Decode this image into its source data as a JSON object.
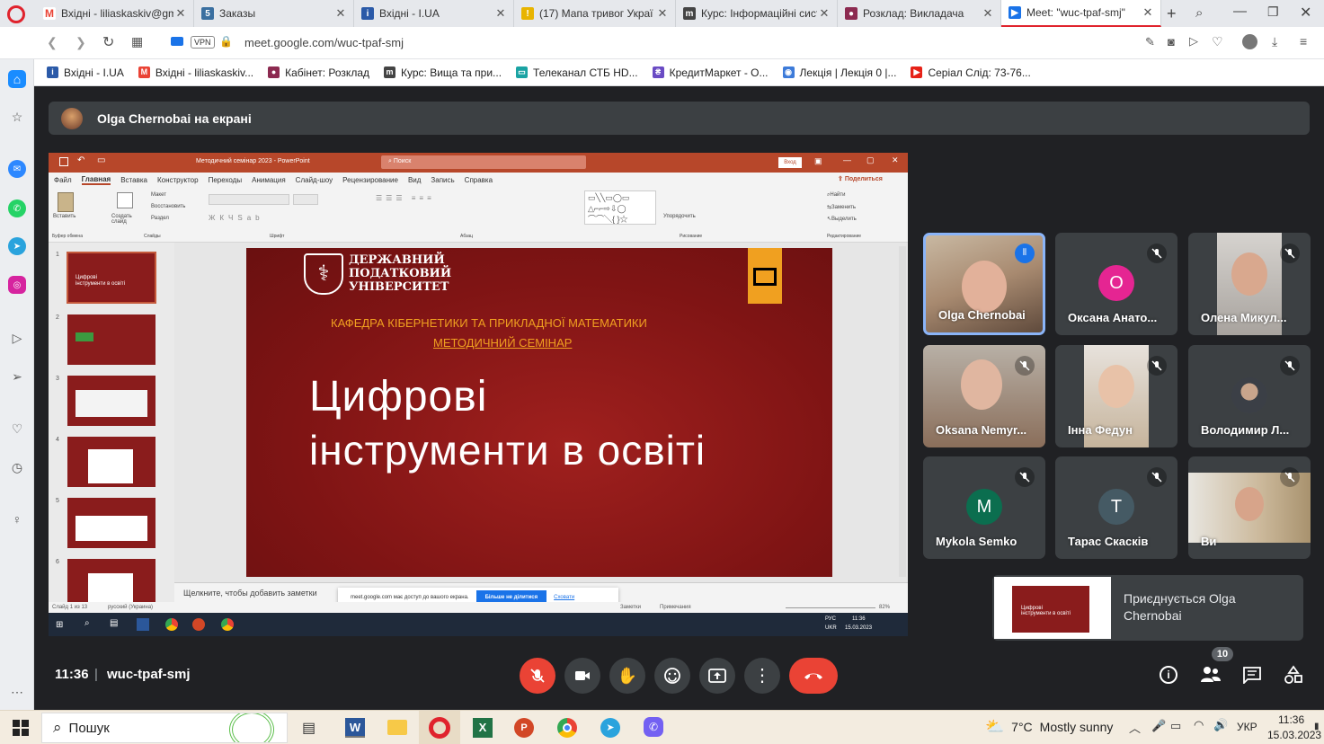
{
  "tabs": [
    {
      "label": "Вхідні - liliaskaskiv@gma",
      "icon": "gmail-icon",
      "color": "#ea4335"
    },
    {
      "label": "Заказы",
      "icon": "orders-icon",
      "color": "#3a6fa0"
    },
    {
      "label": "Вхідні - I.UA",
      "icon": "iua-icon",
      "color": "#2b5aa8"
    },
    {
      "label": "(17) Мапа тривог Украї",
      "icon": "alert-icon",
      "color": "#e8b400"
    },
    {
      "label": "Курс: Інформаційні сист",
      "icon": "moodle-icon",
      "color": "#444"
    },
    {
      "label": "Розклад: Викладача",
      "icon": "schedule-icon",
      "color": "#8c2a50"
    },
    {
      "label": "Meet: \"wuc-tpaf-smj\"",
      "icon": "meet-icon",
      "color": "#1a73e8"
    }
  ],
  "address": {
    "vpn": "VPN",
    "url": "meet.google.com/wuc-tpaf-smj"
  },
  "bookmarks": [
    {
      "label": "Вхідні - I.UA",
      "color": "#2b5aa8"
    },
    {
      "label": "Вхідні - liliaskaskiv...",
      "color": "#ea4335"
    },
    {
      "label": "Кабінет: Розклад",
      "color": "#8c2a50"
    },
    {
      "label": "Курс: Вища та при...",
      "color": "#444"
    },
    {
      "label": "Телеканал СТБ HD...",
      "color": "#1aa3a3"
    },
    {
      "label": "КредитМаркет - О...",
      "color": "#6a4bc4"
    },
    {
      "label": "Лекція | Лекція 0 |...",
      "color": "#3d7bd9"
    },
    {
      "label": "Серіал Слід: 73-76...",
      "color": "#e62117"
    }
  ],
  "banner": {
    "text": "Olga Chernobai на екрані"
  },
  "ppt": {
    "title": "Методичний семінар 2023 - PowerPoint",
    "search": "Поиск",
    "login": "Вход",
    "share": "Поделиться",
    "menu": [
      "Файл",
      "Главная",
      "Вставка",
      "Конструктор",
      "Переходы",
      "Анимация",
      "Слайд-шоу",
      "Рецензирование",
      "Вид",
      "Запись",
      "Справка"
    ],
    "groups": [
      "Буфер обмена",
      "Слайды",
      "Шрифт",
      "Абзац",
      "Рисование",
      "Редактирование"
    ],
    "ribbon": {
      "paste": "Вставить",
      "create": "Создать слайд",
      "layout": "Макет",
      "restore": "Восстановить",
      "section": "Раздел",
      "arrange": "Упорядочить",
      "find": "Найти",
      "replace": "Заменить",
      "select": "Выделить"
    },
    "slide": {
      "univ1": "ДЕРЖАВНИЙ",
      "univ2": "ПОДАТКОВИЙ",
      "univ3": "УНІВЕРСИТЕТ",
      "dept": "КАФЕДРА КІБЕРНЕТИКИ ТА ПРИКЛАДНОЇ МАТЕМАТИКИ",
      "seminar": "МЕТОДИЧНИЙ СЕМІНАР",
      "title1": "Цифрові",
      "title2": "інструменти в освіті"
    },
    "thumbs": [
      "1",
      "2",
      "3",
      "4",
      "5",
      "6"
    ],
    "notes": "Щелкните, чтобы добавить заметки",
    "sharebar": {
      "text": "meet.google.com має доступ до вашого екрана.",
      "stop": "Більше не ділитися",
      "hide": "Сховати"
    },
    "status": {
      "slide": "Слайд 1 из 13",
      "lang": "русский (Украина)",
      "notes": "Заметки",
      "comments": "Примечания",
      "zoom": "82%"
    },
    "tray": {
      "lang1": "РУС",
      "lang2": "UKR",
      "time": "11:36",
      "date": "15.03.2023"
    }
  },
  "participants": [
    {
      "name": "Olga Chernobai",
      "type": "video",
      "speaking": true
    },
    {
      "name": "Оксана Анато...",
      "type": "avatar",
      "letter": "О",
      "color": "#e52592"
    },
    {
      "name": "Олена Микул...",
      "type": "video"
    },
    {
      "name": "Oksana Nemyr...",
      "type": "video"
    },
    {
      "name": "Інна Федун",
      "type": "video"
    },
    {
      "name": "Володимир Л...",
      "type": "photo"
    },
    {
      "name": "Mykola Semko",
      "type": "avatar",
      "letter": "M",
      "color": "#0b6e4f"
    },
    {
      "name": "Тарас Скасків",
      "type": "avatar",
      "letter": "T",
      "color": "#455a64"
    },
    {
      "name": "Ви",
      "type": "video"
    }
  ],
  "joining": {
    "text": "Приєднується Olga Chernobai"
  },
  "bottom": {
    "time": "11:36",
    "separator": "|",
    "code": "wuc-tpaf-smj",
    "people_count": "10"
  },
  "taskbar": {
    "search": "Пошук",
    "weather_temp": "7°C",
    "weather_text": "Mostly sunny",
    "lang": "УКР",
    "time": "11:36",
    "date": "15.03.2023"
  }
}
